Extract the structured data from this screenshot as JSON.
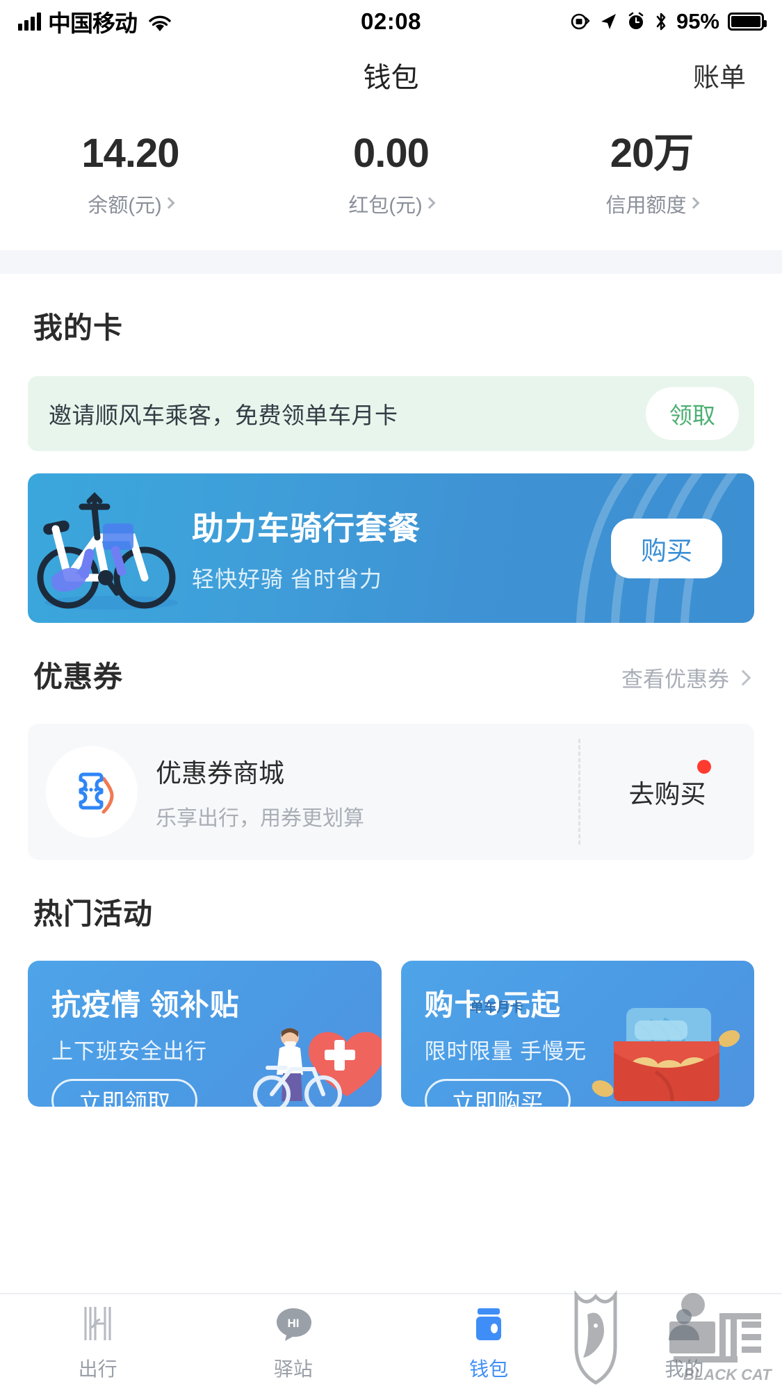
{
  "statusbar": {
    "carrier": "中国移动",
    "time": "02:08",
    "battery_pct": "95%",
    "icons": [
      "signal-bars-icon",
      "wifi-icon",
      "rotation-lock-icon",
      "location-arrow-icon",
      "alarm-clock-icon",
      "bluetooth-icon",
      "battery-icon"
    ]
  },
  "navbar": {
    "title": "钱包",
    "right_action": "账单"
  },
  "balance": {
    "items": [
      {
        "value": "14.20",
        "label": "余额(元)"
      },
      {
        "value": "0.00",
        "label": "红包(元)"
      },
      {
        "value": "20万",
        "label": "信用额度"
      }
    ]
  },
  "my_cards": {
    "title": "我的卡",
    "invite": {
      "text": "邀请顺风车乘客，免费领单车月卡",
      "button": "领取",
      "bg_color": "#e8f5ec",
      "button_text_color": "#4caf72"
    },
    "ebike": {
      "title": "助力车骑行套餐",
      "subtitle": "轻快好骑 省时省力",
      "button": "购买",
      "bg_color": "#3f9ad7",
      "button_text_color": "#3a8fd6"
    }
  },
  "coupons": {
    "title": "优惠券",
    "more": "查看优惠券",
    "mall": {
      "title": "优惠券商城",
      "subtitle": "乐享出行，用券更划算",
      "button": "去购买",
      "badge_color": "#ff3b30",
      "icon": "ticket-icon"
    }
  },
  "hot_activities": {
    "title": "热门活动",
    "cards": [
      {
        "title": "抗疫情 领补贴",
        "subtitle": "上下班安全出行",
        "button": "立即领取",
        "art": "heart-medical-bike-illustration"
      },
      {
        "title": "购卡9元起",
        "subtitle": "限时限量 手慢无",
        "button": "立即购买",
        "art": "red-envelope-card-illustration",
        "art_label": "单车月卡"
      }
    ]
  },
  "tabbar": {
    "active_color": "#3f8ef7",
    "inactive_color": "#9aa0a8",
    "items": [
      {
        "label": "出行",
        "icon": "hellobike-logo-icon",
        "active": false
      },
      {
        "label": "驿站",
        "icon": "hi-chat-bubble-icon",
        "active": false
      },
      {
        "label": "钱包",
        "icon": "wallet-icon",
        "active": true
      },
      {
        "label": "我的",
        "icon": "user-profile-icon",
        "active": false
      }
    ]
  },
  "watermark": {
    "text": "黑猫",
    "subtext": "BLACK CAT"
  }
}
